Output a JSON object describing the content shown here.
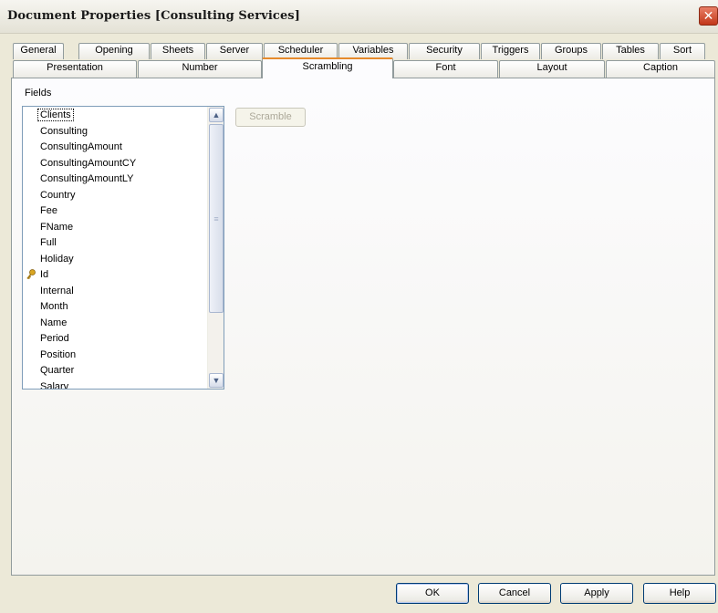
{
  "window": {
    "title": "Document Properties [Consulting Services]",
    "close_glyph": "✕"
  },
  "tabs": {
    "row1": [
      "General",
      "Opening",
      "Sheets",
      "Server",
      "Scheduler",
      "Variables",
      "Security",
      "Triggers",
      "Groups",
      "Tables",
      "Sort"
    ],
    "row2": [
      "Presentation",
      "Number",
      "Scrambling",
      "Font",
      "Layout",
      "Caption"
    ],
    "active": "Scrambling"
  },
  "fields": {
    "label": "Fields",
    "items": [
      "Clients",
      "Consulting",
      "ConsultingAmount",
      "ConsultingAmountCY",
      "ConsultingAmountLY",
      "Country",
      "Fee",
      "FName",
      "Full",
      "Holiday",
      "Id",
      "Internal",
      "Month",
      "Name",
      "Period",
      "Position",
      "Quarter",
      "Salary"
    ],
    "selected": "Clients",
    "key_field": "Id",
    "key_icon": "key-icon"
  },
  "scramble_button": "Scramble",
  "footer": {
    "ok": "OK",
    "cancel": "Cancel",
    "apply": "Apply",
    "help": "Help"
  }
}
